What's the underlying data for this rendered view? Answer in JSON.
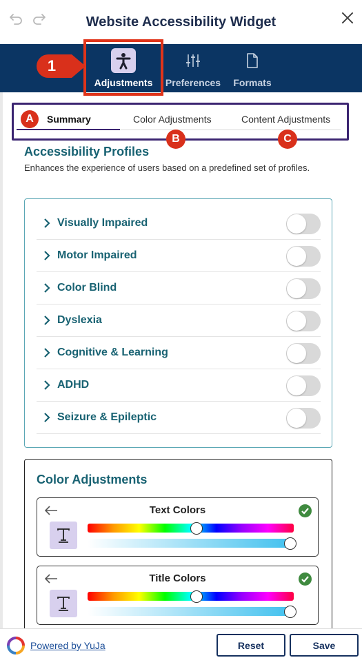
{
  "header": {
    "title": "Website Accessibility Widget",
    "undo_icon": "undo-icon",
    "redo_icon": "redo-icon",
    "close_icon": "close-icon"
  },
  "nav": {
    "items": [
      {
        "label": "Adjustments",
        "icon": "accessibility-person-icon",
        "active": true
      },
      {
        "label": "Preferences",
        "icon": "sliders-icon",
        "active": false
      },
      {
        "label": "Formats",
        "icon": "document-icon",
        "active": false
      }
    ]
  },
  "annotations": {
    "one": "1",
    "a": "A",
    "b": "B",
    "c": "C"
  },
  "tabs": [
    {
      "label": "Summary",
      "active": true
    },
    {
      "label": "Color Adjustments",
      "active": false
    },
    {
      "label": "Content Adjustments",
      "active": false
    }
  ],
  "profiles": {
    "title": "Accessibility Profiles",
    "description": "Enhances the experience of users based on a predefined set of profiles.",
    "items": [
      {
        "label": "Visually Impaired",
        "enabled": false
      },
      {
        "label": "Motor Impaired",
        "enabled": false
      },
      {
        "label": "Color Blind",
        "enabled": false
      },
      {
        "label": "Dyslexia",
        "enabled": false
      },
      {
        "label": "Cognitive & Learning",
        "enabled": false
      },
      {
        "label": "ADHD",
        "enabled": false
      },
      {
        "label": "Seizure & Epileptic",
        "enabled": false
      }
    ]
  },
  "color_adjustments": {
    "title": "Color Adjustments",
    "cards": [
      {
        "label": "Text Colors",
        "hue_position": 0.53,
        "lightness_position": 1.0,
        "checked": true
      },
      {
        "label": "Title Colors",
        "hue_position": 0.53,
        "lightness_position": 1.0,
        "checked": true
      }
    ]
  },
  "footer": {
    "powered_by": "Powered by YuJa",
    "reset_label": "Reset",
    "save_label": "Save"
  },
  "colors": {
    "nav_background": "#0b3563",
    "accent_teal": "#186272",
    "annotation_red": "#d9301b",
    "tab_box_purple": "#3b2471"
  }
}
